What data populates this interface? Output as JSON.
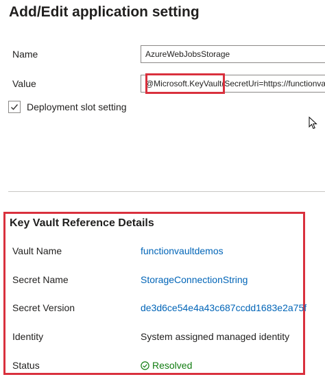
{
  "title": "Add/Edit application setting",
  "form": {
    "name_label": "Name",
    "name_value": "AzureWebJobsStorage",
    "value_label": "Value",
    "value_value": "@Microsoft.KeyVault(SecretUri=https://functionvault",
    "slot_setting_label": "Deployment slot setting",
    "slot_setting_checked": true
  },
  "key_vault": {
    "title": "Key Vault Reference Details",
    "rows": [
      {
        "label": "Vault Name",
        "value": "functionvaultdemos",
        "link": true
      },
      {
        "label": "Secret Name",
        "value": "StorageConnectionString",
        "link": true
      },
      {
        "label": "Secret Version",
        "value": "de3d6ce54e4a43c687ccdd1683e2a75f",
        "link": true
      },
      {
        "label": "Identity",
        "value": "System assigned managed identity",
        "link": false
      },
      {
        "label": "Status",
        "value": "Resolved",
        "link": false
      }
    ]
  },
  "colors": {
    "highlight": "#d9303d",
    "link": "#0064b7",
    "success": "#107c10"
  },
  "icons": {
    "checkbox": "checkmark-icon",
    "cursor": "mouse-pointer-icon",
    "status": "check-circle-icon"
  }
}
